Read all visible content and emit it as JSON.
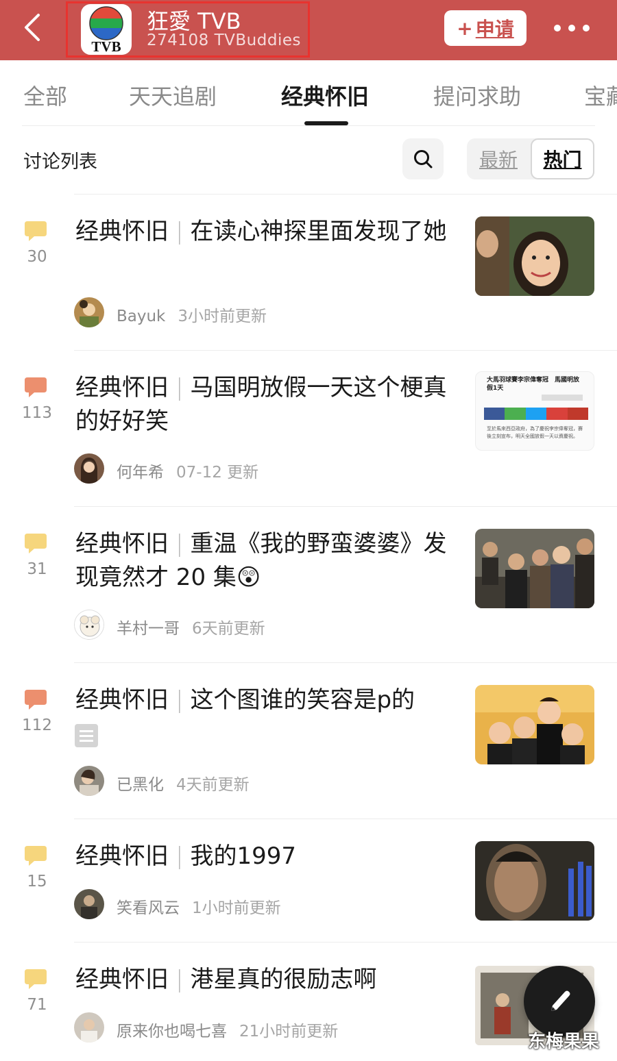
{
  "header": {
    "group_name": "狂愛 TVB",
    "members": "274108 TVBuddies",
    "logo_text": "TVB",
    "apply_plus": "+",
    "apply_label": "申请",
    "accent": "#c9524f",
    "highlight_border": "#e8332f"
  },
  "tabs": [
    {
      "label": "全部",
      "active": false
    },
    {
      "label": "天天追剧",
      "active": false
    },
    {
      "label": "经典怀旧",
      "active": true
    },
    {
      "label": "提问求助",
      "active": false
    },
    {
      "label": "宝藏",
      "active": false
    }
  ],
  "list": {
    "title": "讨论列表",
    "sort_latest": "最新",
    "sort_hot": "热门",
    "sort_selected": "热门"
  },
  "posts": [
    {
      "count": "30",
      "category": "经典怀旧",
      "sep": "|",
      "title": "在读心神探里面发现了她",
      "author": "Bayuk",
      "time": "3小时前更新",
      "bubble": "yellow"
    },
    {
      "count": "113",
      "category": "经典怀旧",
      "sep": "|",
      "title": "马国明放假一天这个梗真的好好笑",
      "author": "何年希",
      "time": "07-12 更新",
      "bubble": "orange",
      "thumb_text": {
        "headline": "大馬羽球賽李宗偉奪冠　馬國明放假1天",
        "body": "至於馬來西亞政府，為了慶祝李宗偉奪冠，賽後立刻宣布，明天全國放假一天以資慶祝。"
      }
    },
    {
      "count": "31",
      "category": "经典怀旧",
      "sep": "|",
      "title": "重温《我的野蛮婆婆》发现竟然才 20 集",
      "emoji": "😲",
      "author": "羊村一哥",
      "time": "6天前更新",
      "bubble": "yellow"
    },
    {
      "count": "112",
      "category": "经典怀旧",
      "sep": "|",
      "title": "这个图谁的笑容是p的",
      "author": "已黑化",
      "time": "4天前更新",
      "bubble": "orange",
      "has_doc_icon": true
    },
    {
      "count": "15",
      "category": "经典怀旧",
      "sep": "|",
      "title": "我的1997",
      "author": "笑看风云",
      "time": "1小时前更新",
      "bubble": "yellow"
    },
    {
      "count": "71",
      "category": "经典怀旧",
      "sep": "|",
      "title": "港星真的很励志啊",
      "author": "原来你也喝七喜",
      "time": "21小时前更新",
      "bubble": "yellow"
    }
  ],
  "colors": {
    "bubble_yellow": "#f6d67d",
    "bubble_orange": "#ec8f6e",
    "active_indicator": "#1a1a1a"
  },
  "watermark": "东梅果果"
}
